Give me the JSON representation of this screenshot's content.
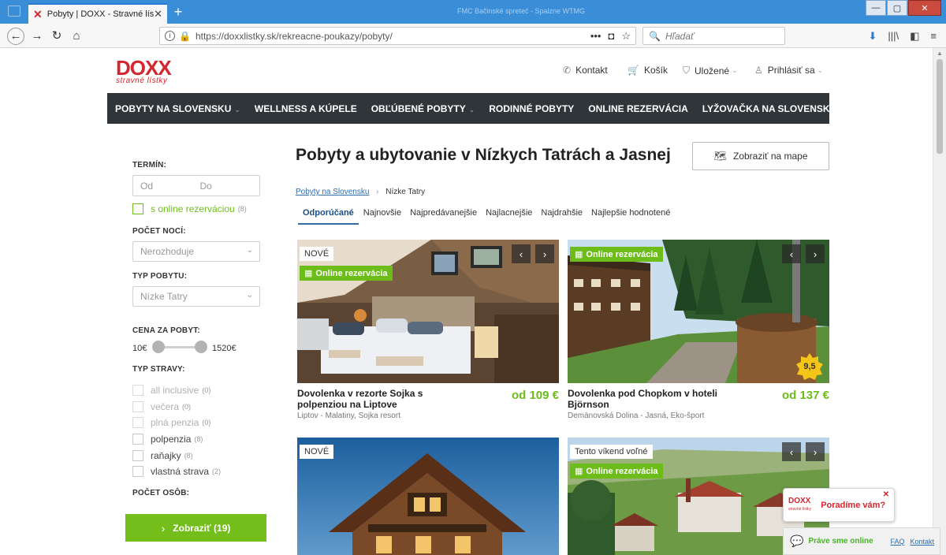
{
  "browser": {
    "tab_title": "Pobyty | DOXX - Stravné lístky",
    "window_title": "FMC Bačinské spreteč - Spalzne WTMG",
    "url": "https://doxxlistky.sk/rekreacne-poukazy/pobyty/",
    "search_placeholder": "Hľadať"
  },
  "site": {
    "logo_brand": "DOXX",
    "logo_sub": "stravné lístky",
    "top_nav": [
      "Kontakt",
      "Košík",
      "Uložené",
      "Prihlásiť sa"
    ],
    "main_nav": [
      {
        "label": "POBYTY NA SLOVENSKU",
        "dropdown": true
      },
      {
        "label": "WELLNESS A KÚPELE",
        "dropdown": false
      },
      {
        "label": "OBĽÚBENÉ POBYTY",
        "dropdown": true
      },
      {
        "label": "RODINNÉ POBYTY",
        "dropdown": false
      },
      {
        "label": "ONLINE REZERVÁCIA",
        "dropdown": false
      },
      {
        "label": "LYŽOVAČKA NA SLOVENSKU",
        "dropdown": false
      }
    ]
  },
  "filters": {
    "term_label": "TERMÍN:",
    "date_from_placeholder": "Od",
    "date_to_placeholder": "Do",
    "online_label": "s online rezerváciou",
    "online_count": "(8)",
    "nights_label": "POČET NOCÍ:",
    "nights_value": "Nerozhoduje",
    "type_label": "TYP POBYTU:",
    "type_value": "Nízke Tatry",
    "price_label": "CENA ZA POBYT:",
    "price_min": "10€",
    "price_max": "1520€",
    "meal_label": "TYP STRAVY:",
    "meals": [
      {
        "label": "all inclusive",
        "count": "(0)",
        "enabled": false
      },
      {
        "label": "večera",
        "count": "(0)",
        "enabled": false
      },
      {
        "label": "plná penzia",
        "count": "(0)",
        "enabled": false
      },
      {
        "label": "polpenzia",
        "count": "(8)",
        "enabled": true
      },
      {
        "label": "raňajky",
        "count": "(8)",
        "enabled": true
      },
      {
        "label": "vlastná strava",
        "count": "(2)",
        "enabled": true
      }
    ],
    "persons_label": "POČET OSÔB:",
    "show_button": "Zobraziť (19)"
  },
  "main": {
    "title": "Pobyty a ubytovanie v Nízkych Tatrách a Jasnej",
    "map_button": "Zobraziť na mape",
    "breadcrumb": [
      "Pobyty na Slovensku",
      "Nízke Tatry"
    ],
    "sort_tabs": [
      "Odporúčané",
      "Najnovšie",
      "Najpredávanejšie",
      "Najlacnejšie",
      "Najdrahšie",
      "Najlepšie hodnotené"
    ],
    "active_sort": 0,
    "cards": [
      {
        "badges": [
          "NOVÉ",
          "Online rezervácia"
        ],
        "title": "Dovolenka v rezorte Sojka s polpenziou na Liptove",
        "price": "od 109 €",
        "location": "Liptov - Malatiny, Sojka resort"
      },
      {
        "badges": [
          "Online rezervácia"
        ],
        "title": "Dovolenka pod Chopkom v hoteli Björnson",
        "price": "od 137 €",
        "location": "Demänovská Dolina - Jasná, Eko-šport",
        "rating": "9,5"
      },
      {
        "badges": [
          "NOVÉ"
        ]
      },
      {
        "badges": [
          "Tento víkend voľné",
          "Online rezervácia"
        ]
      }
    ]
  },
  "chat": {
    "logo": "DOXX",
    "logo_sub": "stravné lístky",
    "question": "Poradíme vám?",
    "status": "Práve sme online",
    "faq": "FAQ",
    "contact": "Kontakt"
  },
  "colors": {
    "brand_red": "#d4262e",
    "accent_green": "#6cbc1a",
    "nav_dark": "#2f3539"
  }
}
